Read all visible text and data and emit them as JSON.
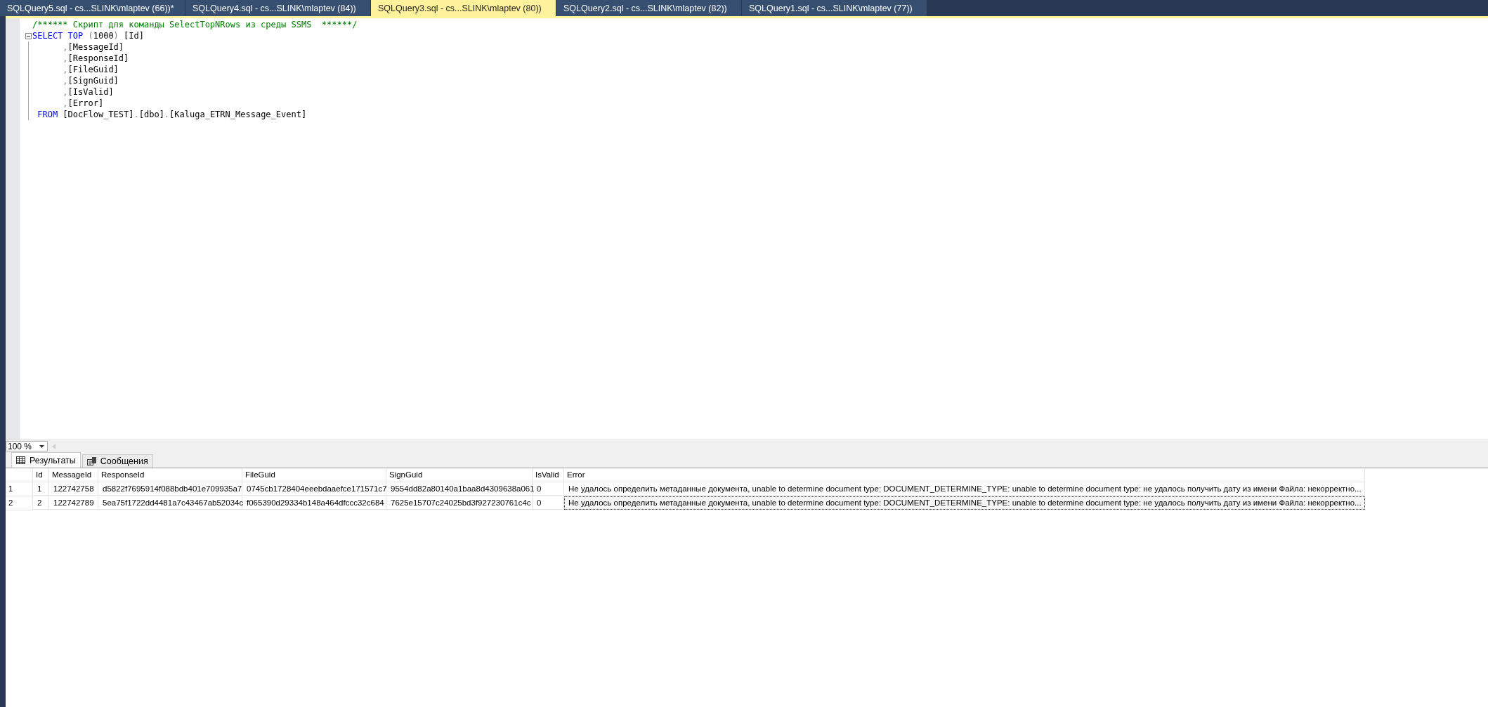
{
  "tabs": [
    {
      "label": "SQLQuery5.sql - cs...SLINK\\mlaptev (66))*",
      "selected": false
    },
    {
      "label": "SQLQuery4.sql - cs...SLINK\\mlaptev (84))",
      "selected": false
    },
    {
      "label": "SQLQuery3.sql - cs...SLINK\\mlaptev (80))",
      "selected": true
    },
    {
      "label": "SQLQuery2.sql - cs...SLINK\\mlaptev (82))",
      "selected": false
    },
    {
      "label": "SQLQuery1.sql - cs...SLINK\\mlaptev (77))",
      "selected": false
    }
  ],
  "editor": {
    "lines": [
      {
        "fold": false,
        "tokens": [
          {
            "kind": "comment",
            "text": "/****** Скрипт для команды SelectTopNRows из среды SSMS  ******/"
          }
        ]
      },
      {
        "fold": true,
        "tokens": [
          {
            "kind": "keyword",
            "text": "SELECT TOP"
          },
          {
            "kind": "punct",
            "text": " ("
          },
          {
            "kind": "plain",
            "text": "1000"
          },
          {
            "kind": "punct",
            "text": ")"
          },
          {
            "kind": "plain",
            "text": " [Id]"
          }
        ]
      },
      {
        "fold": false,
        "tokens": [
          {
            "kind": "punct",
            "text": "      ,"
          },
          {
            "kind": "plain",
            "text": "[MessageId]"
          }
        ]
      },
      {
        "fold": false,
        "tokens": [
          {
            "kind": "punct",
            "text": "      ,"
          },
          {
            "kind": "plain",
            "text": "[ResponseId]"
          }
        ]
      },
      {
        "fold": false,
        "tokens": [
          {
            "kind": "punct",
            "text": "      ,"
          },
          {
            "kind": "plain",
            "text": "[FileGuid]"
          }
        ]
      },
      {
        "fold": false,
        "tokens": [
          {
            "kind": "punct",
            "text": "      ,"
          },
          {
            "kind": "plain",
            "text": "[SignGuid]"
          }
        ]
      },
      {
        "fold": false,
        "tokens": [
          {
            "kind": "punct",
            "text": "      ,"
          },
          {
            "kind": "plain",
            "text": "[IsValid]"
          }
        ]
      },
      {
        "fold": false,
        "tokens": [
          {
            "kind": "punct",
            "text": "      ,"
          },
          {
            "kind": "plain",
            "text": "[Error]"
          }
        ]
      },
      {
        "fold": false,
        "tokens": [
          {
            "kind": "keyword",
            "text": " FROM"
          },
          {
            "kind": "plain",
            "text": " [DocFlow_TEST]"
          },
          {
            "kind": "punct",
            "text": "."
          },
          {
            "kind": "plain",
            "text": "[dbo]"
          },
          {
            "kind": "punct",
            "text": "."
          },
          {
            "kind": "plain",
            "text": "[Kaluga_ETRN_Message_Event]"
          }
        ]
      }
    ]
  },
  "zoom": {
    "value": "100 %"
  },
  "result_tabs": [
    {
      "label": "Результаты",
      "kind": "grid",
      "selected": true
    },
    {
      "label": "Сообщения",
      "kind": "messages",
      "selected": false
    }
  ],
  "grid": {
    "columns": [
      "Id",
      "MessageId",
      "ResponseId",
      "FileGuid",
      "SignGuid",
      "IsValid",
      "Error"
    ],
    "rows": [
      {
        "number": "1",
        "cells": [
          {
            "text": "1",
            "focused": false
          },
          {
            "text": "122742758",
            "focused": false
          },
          {
            "text": "d5822f7695914f088bdb401e709935a7",
            "focused": false
          },
          {
            "text": "0745cb1728404eeebdaaefce171571c7",
            "focused": false
          },
          {
            "text": "9554dd82a80140a1baa8d4309638a061",
            "focused": false
          },
          {
            "text": "0",
            "focused": false
          },
          {
            "text": "Не удалось определить метаданные документа, unable to determine document type: DOCUMENT_DETERMINE_TYPE: unable to determine document type: не удалось получить дату из имени Файла: некорректно...",
            "focused": false
          }
        ]
      },
      {
        "number": "2",
        "cells": [
          {
            "text": "2",
            "focused": false
          },
          {
            "text": "122742789",
            "focused": false
          },
          {
            "text": "5ea75f1722dd4481a7c43467ab52034c",
            "focused": false
          },
          {
            "text": "f065390d29334b148a464dfccc32c684",
            "focused": false
          },
          {
            "text": "7625e15707c24025bd3f927230761c4c",
            "focused": false
          },
          {
            "text": "0",
            "focused": false
          },
          {
            "text": "Не удалось определить метаданные документа, unable to determine document type: DOCUMENT_DETERMINE_TYPE: unable to determine document type: не удалось получить дату из имени Файла: некорректно...",
            "focused": true
          }
        ]
      }
    ]
  }
}
